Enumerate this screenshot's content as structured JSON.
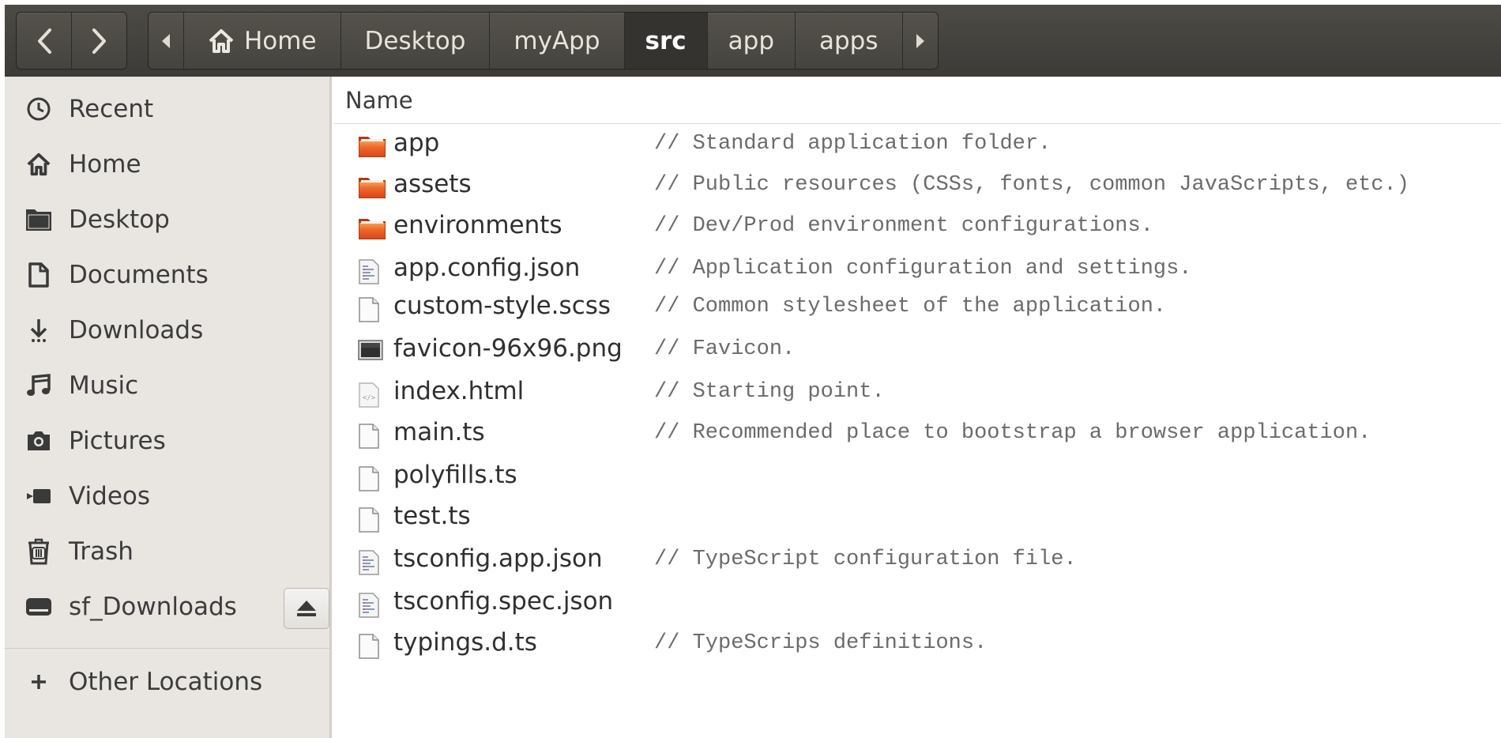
{
  "toolbar": {
    "back_label": "<",
    "forward_label": ">",
    "crumb_left_arrow": "◂",
    "crumb_right_arrow": "▸",
    "breadcrumbs": [
      {
        "label": "Home",
        "icon": "home-icon"
      },
      {
        "label": "Desktop"
      },
      {
        "label": "myApp"
      },
      {
        "label": "src",
        "active": true
      },
      {
        "label": "app"
      },
      {
        "label": "apps"
      }
    ]
  },
  "sidebar": {
    "items": [
      {
        "label": "Recent",
        "icon": "clock-icon"
      },
      {
        "label": "Home",
        "icon": "home-icon"
      },
      {
        "label": "Desktop",
        "icon": "folder-icon"
      },
      {
        "label": "Documents",
        "icon": "document-icon"
      },
      {
        "label": "Downloads",
        "icon": "download-icon"
      },
      {
        "label": "Music",
        "icon": "music-icon"
      },
      {
        "label": "Pictures",
        "icon": "camera-icon"
      },
      {
        "label": "Videos",
        "icon": "video-icon"
      },
      {
        "label": "Trash",
        "icon": "trash-icon"
      },
      {
        "label": "sf_Downloads",
        "icon": "drive-icon"
      }
    ],
    "other_locations": {
      "label": "Other Locations",
      "icon": "plus-icon"
    }
  },
  "content": {
    "column_header": "Name",
    "files": [
      {
        "name": "app",
        "type": "folder",
        "comment": "// Standard application folder."
      },
      {
        "name": "assets",
        "type": "folder",
        "comment": "// Public resources (CSSs, fonts, common JavaScripts, etc.)"
      },
      {
        "name": "environments",
        "type": "folder",
        "comment": "// Dev/Prod environment configurations."
      },
      {
        "name": "app.config.json",
        "type": "json",
        "comment": "// Application configuration and settings."
      },
      {
        "name": "custom-style.scss",
        "type": "text",
        "comment": "// Common stylesheet of the application."
      },
      {
        "name": "favicon-96x96.png",
        "type": "image",
        "comment": "// Favicon."
      },
      {
        "name": "index.html",
        "type": "html",
        "comment": "// Starting point."
      },
      {
        "name": "main.ts",
        "type": "text",
        "comment": "// Recommended place to bootstrap a browser application."
      },
      {
        "name": "polyfills.ts",
        "type": "text",
        "comment": ""
      },
      {
        "name": "test.ts",
        "type": "text",
        "comment": ""
      },
      {
        "name": "tsconfig.app.json",
        "type": "json",
        "comment": "// TypeScript configuration file."
      },
      {
        "name": "tsconfig.spec.json",
        "type": "json",
        "comment": ""
      },
      {
        "name": "typings.d.ts",
        "type": "text",
        "comment": "// TypeScrips definitions."
      }
    ]
  },
  "colors": {
    "titlebar": "#3c3b37",
    "sidebar": "#e9e6e2",
    "folder_orange": "#e9541e",
    "comment_text": "#6b6b6b"
  }
}
